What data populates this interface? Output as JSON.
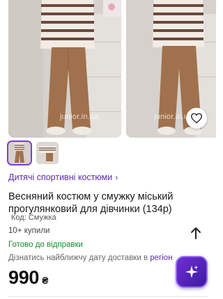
{
  "gallery": {
    "watermark": "junior.in.ua",
    "photo_count": 2
  },
  "favorite": {
    "icon": "heart-icon"
  },
  "thumbnails": [
    {
      "icon": "product-thumbnail",
      "active": true
    },
    {
      "icon": "product-thumbnail",
      "active": false
    }
  ],
  "product": {
    "category": "Дитячі спортивні костюми",
    "category_chevron": "›",
    "title": "Весняний костюм у смужку міський прогулянковий для дівчинки (134р)",
    "code": "Код: Смужка",
    "bought": "10+ купили",
    "ready": "Готово до відправки",
    "delivery_prefix": "Дізнатись найближчу дату доставки в ",
    "delivery_region": "регіон",
    "price": "990",
    "currency": "₴"
  },
  "colors": {
    "accent": "#5b2bb5",
    "ready_green": "#168a2c",
    "ai_button": "#6e2fd6"
  },
  "actions": {
    "share_icon": "arrow-up-icon",
    "ai_icon": "sparkle-icon"
  }
}
